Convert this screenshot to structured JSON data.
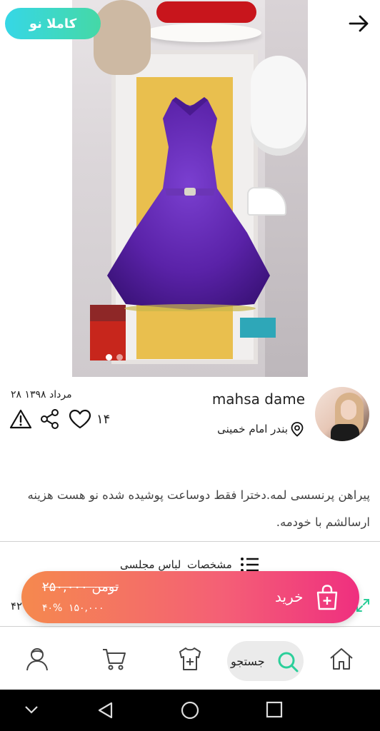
{
  "hero": {
    "badge_text": "کاملا نو",
    "back_icon": "arrow-right-icon",
    "image_count": 2,
    "active_image": 1,
    "badge_gradient": [
      "#36d7e6",
      "#45d8a6"
    ]
  },
  "seller": {
    "name": "mahsa dame",
    "location": "بندر امام خمینی",
    "location_icon": "map-pin-icon",
    "date": "۲۸ مرداد ۱۳۹۸",
    "likes": "۱۴"
  },
  "actions": {
    "like_icon": "heart-icon",
    "share_icon": "share-icon",
    "report_icon": "warning-icon"
  },
  "description": "پیراهن پرنسسی لمه.دخترا فقط دوساعت پوشیده شده نو هست هزینه ارسالشم با خودمه.",
  "specs": {
    "label": "مشخصات",
    "category": "لباس مجلسی",
    "left_number": "۴۲"
  },
  "buy": {
    "label": "خرید",
    "old_price": "۲۵۰,۰۰۰ تومن",
    "discount": "۴۰%",
    "new_price": "۱۵۰,۰۰۰",
    "gradient": [
      "#f5894e",
      "#f45f76",
      "#ef2f7f"
    ]
  },
  "bottom_nav": {
    "search_label": "جستجو",
    "items": [
      "home-icon",
      "search-icon",
      "add-item-icon",
      "cart-icon",
      "profile-icon"
    ],
    "accent": "#2bcf9a"
  },
  "system_nav": [
    "chevron-down-icon",
    "back-icon",
    "home-circle-icon",
    "recents-icon"
  ]
}
